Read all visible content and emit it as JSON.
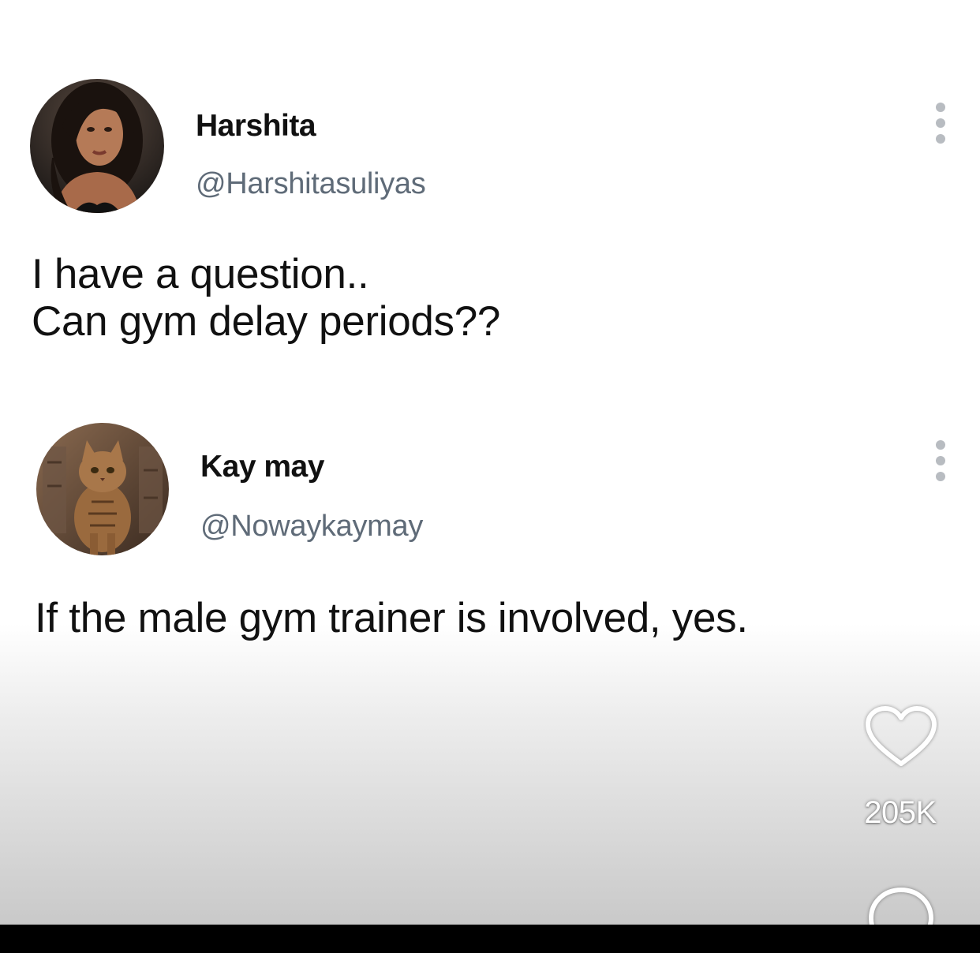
{
  "posts": [
    {
      "display_name": "Harshita",
      "handle": "@Harshitasuliyas",
      "text_lines": [
        "I have a question..",
        "Can gym delay periods??"
      ],
      "avatar_icon": "woman-selfie-avatar"
    },
    {
      "display_name": "Kay may",
      "handle": "@Nowaykaymay",
      "text_lines": [
        "If the male gym trainer is involved, yes."
      ],
      "avatar_icon": "tabby-cat-avatar"
    }
  ],
  "actions": {
    "like_icon": "heart-icon",
    "like_count": "205K",
    "comment_icon": "comment-bubble-icon",
    "more_icon": "vertical-dots-icon"
  },
  "colors": {
    "text_primary": "#111111",
    "handle_gray": "#5f6b78",
    "dots_gray": "#b8bcc1",
    "bottom_bar": "#000000"
  }
}
